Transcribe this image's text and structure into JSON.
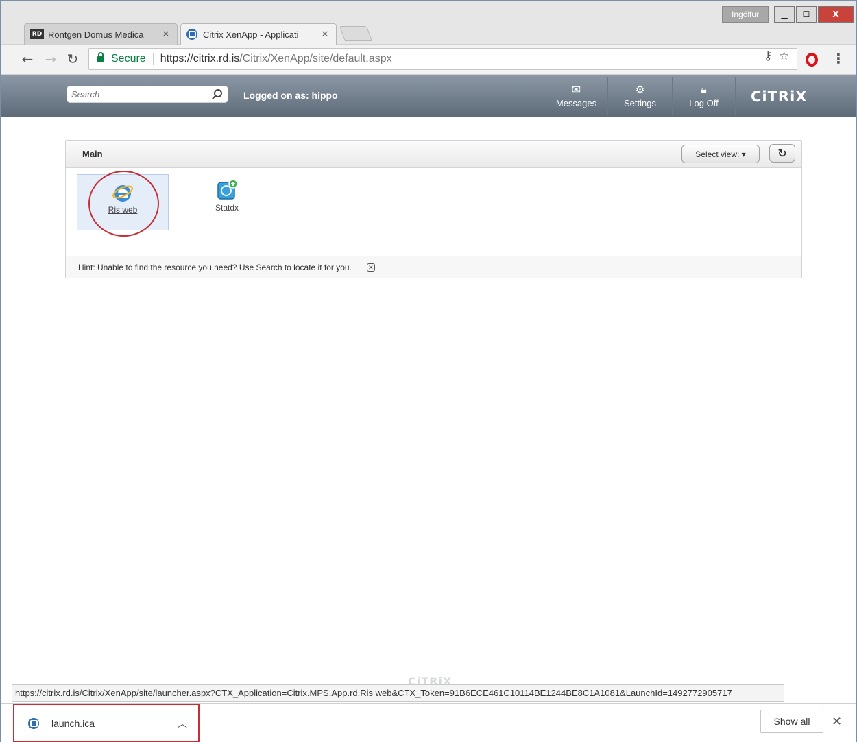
{
  "browser": {
    "tabs": [
      {
        "favicon": "RD",
        "title": "Röntgen Domus Medica"
      },
      {
        "title": "Citrix XenApp - Applicati"
      }
    ],
    "user_label": "Ingólfur",
    "omnibox": {
      "secure_label": "Secure",
      "url_host": "https://citrix.rd.is",
      "url_path": "/Citrix/XenApp/site/default.aspx"
    },
    "status_url": "https://citrix.rd.is/Citrix/XenApp/site/launcher.aspx?CTX_Application=Citrix.MPS.App.rd.Ris web&CTX_Token=91B6ECE461C10114BE1244BE8C1A1081&LaunchId=1492772905717"
  },
  "citrix_header": {
    "search_placeholder": "Search",
    "logged_on": "Logged on as: hippo",
    "buttons": [
      {
        "label": "Messages",
        "icon": "envelope-icon"
      },
      {
        "label": "Settings",
        "icon": "gear-icon"
      },
      {
        "label": "Log Off",
        "icon": "lock-icon"
      }
    ],
    "logo_text": "CiTRiX"
  },
  "main_panel": {
    "title": "Main",
    "select_view_label": "Select view: ▾",
    "apps": [
      {
        "label": "Ris web",
        "icon": "internet-explorer-icon"
      },
      {
        "label": "Statdx",
        "icon": "statdx-app-icon"
      }
    ],
    "hint": "Hint: Unable to find the resource you need? Use Search to locate it for you."
  },
  "download_shelf": {
    "file_name": "launch.ica",
    "show_all_label": "Show all"
  },
  "colors": {
    "header_top": "#8c98a5",
    "header_bottom": "#5e6b79",
    "annotation_red": "#c62d35",
    "secure_green": "#0b8043",
    "close_red": "#c9433a"
  }
}
